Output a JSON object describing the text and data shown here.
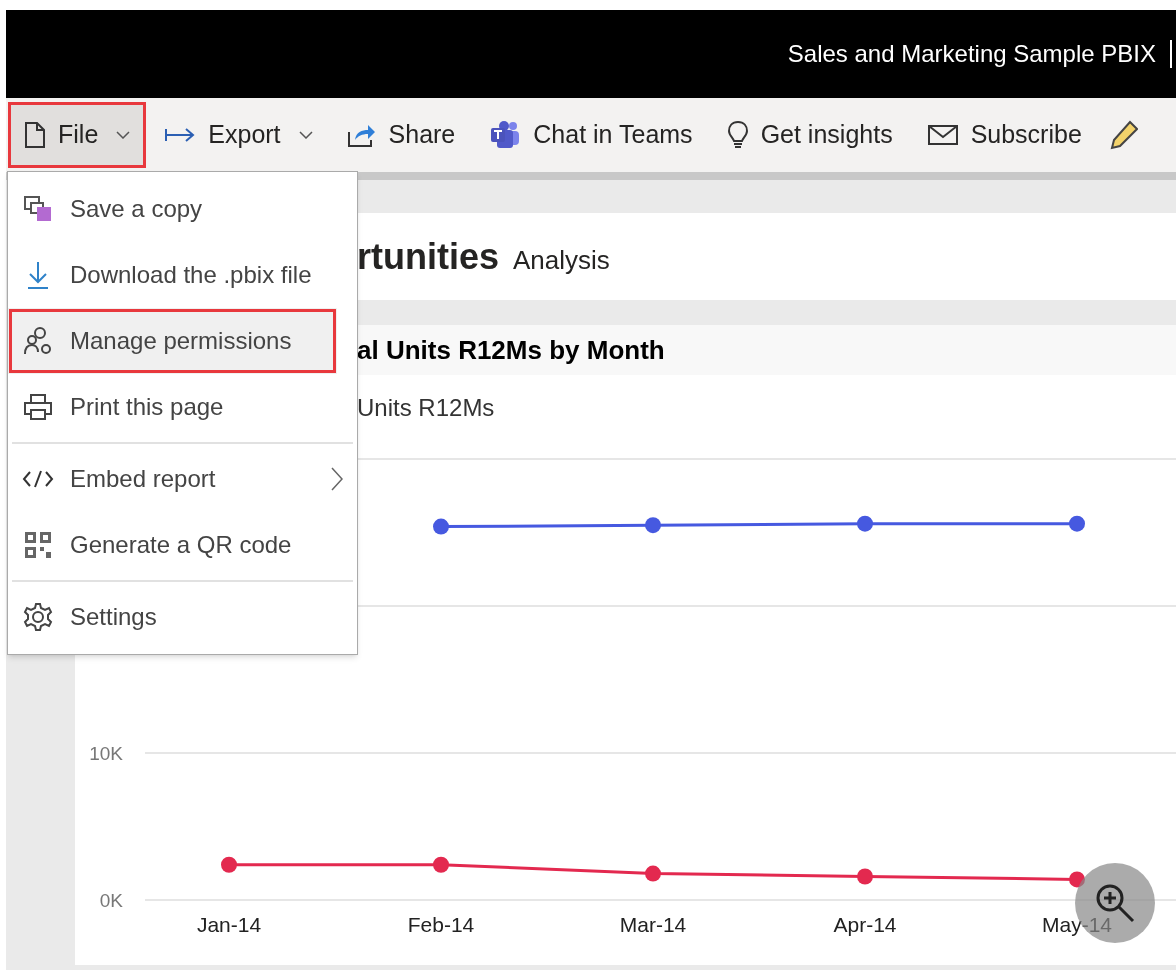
{
  "window": {
    "title": "Sales and Marketing Sample PBIX"
  },
  "toolbar": [
    {
      "label": "File",
      "dropdown": true,
      "selected": true,
      "annotated": true
    },
    {
      "label": "Export",
      "dropdown": true,
      "selected": false,
      "annotated": false
    },
    {
      "label": "Share",
      "dropdown": false,
      "selected": false,
      "annotated": false
    },
    {
      "label": "Chat in Teams",
      "dropdown": false,
      "selected": false,
      "annotated": false
    },
    {
      "label": "Get insights",
      "dropdown": false,
      "selected": false,
      "annotated": false
    },
    {
      "label": "Subscribe",
      "dropdown": false,
      "selected": false,
      "annotated": false
    }
  ],
  "file_menu": {
    "groups": [
      [
        {
          "label": "Save a copy",
          "selected": false,
          "annotated": false,
          "submenu": false
        },
        {
          "label": "Download the .pbix file",
          "selected": false,
          "annotated": false,
          "submenu": false
        },
        {
          "label": "Manage permissions",
          "selected": true,
          "annotated": true,
          "submenu": false
        },
        {
          "label": "Print this page",
          "selected": false,
          "annotated": false,
          "submenu": false
        }
      ],
      [
        {
          "label": "Embed report",
          "selected": false,
          "annotated": false,
          "submenu": true
        },
        {
          "label": "Generate a QR code",
          "selected": false,
          "annotated": false,
          "submenu": false
        }
      ],
      [
        {
          "label": "Settings",
          "selected": false,
          "annotated": false,
          "submenu": false
        }
      ]
    ]
  },
  "report": {
    "title": "rtunities",
    "subtitle": "Analysis",
    "visual": {
      "title": "al Units R12Ms by Month",
      "legend": "Units R12Ms",
      "chart_data": {
        "type": "line",
        "categories": [
          "Jan-14",
          "Feb-14",
          "Mar-14",
          "Apr-14",
          "May-14"
        ],
        "series": [
          {
            "color": "#4659e0",
            "marker": "circle",
            "values": [
              null,
              25400,
              25500,
              25600,
              25600
            ]
          },
          {
            "color": "#e3294f",
            "marker": "circle",
            "values": [
              2400,
              2400,
              1800,
              1600,
              1400
            ]
          }
        ],
        "ylim": [
          0,
          30000
        ],
        "yticks": [
          {
            "value": 0,
            "label": "0K"
          },
          {
            "value": 10000,
            "label": "10K"
          }
        ]
      }
    }
  }
}
